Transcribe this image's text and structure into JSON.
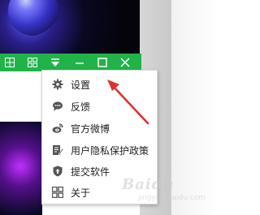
{
  "menu": {
    "items": [
      {
        "label": "设置",
        "icon": "gear-icon"
      },
      {
        "label": "反馈",
        "icon": "chat-bubble-icon"
      },
      {
        "label": "官方微博",
        "icon": "weibo-icon"
      },
      {
        "label": "用户隐私保护政策",
        "icon": "document-edit-icon"
      },
      {
        "label": "提交软件",
        "icon": "shield-upload-icon"
      },
      {
        "label": "关于",
        "icon": "app-grid-icon"
      }
    ]
  },
  "title_bar": {
    "color": "#21b34a",
    "buttons": [
      "grid-icon",
      "skin-icon",
      "dropdown-triangle-icon",
      "minimize-icon",
      "maximize-icon",
      "close-icon"
    ]
  },
  "annotation": {
    "color": "#e0322d"
  },
  "watermark": {
    "text": "Baidu",
    "sub": "jingyan.baidu.com"
  }
}
